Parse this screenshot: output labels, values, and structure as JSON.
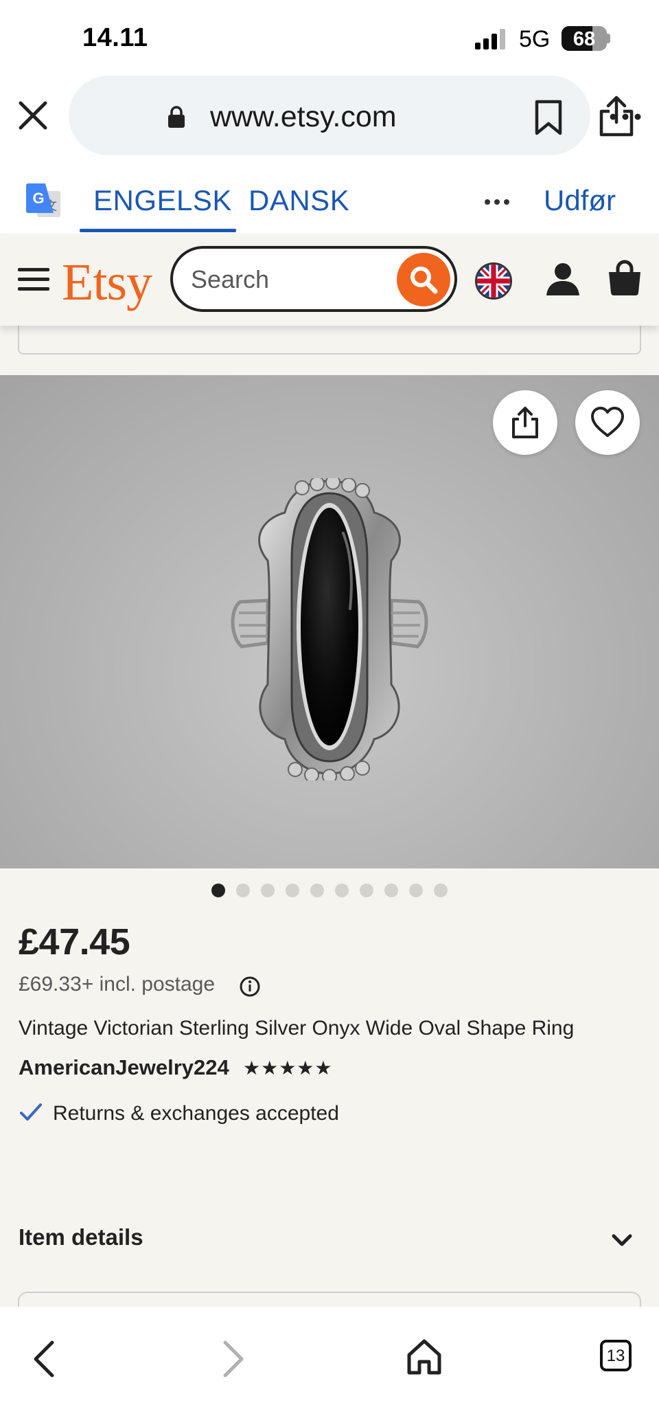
{
  "status_bar": {
    "time": "14.11",
    "network": "5G",
    "battery": "68",
    "battery_level": 0.68
  },
  "browser": {
    "url": "www.etsy.com"
  },
  "translate_bar": {
    "tab_english": "ENGELSK",
    "tab_danish": "DANSK",
    "action": "Udfør"
  },
  "etsy_header": {
    "logo": "Etsy",
    "search_placeholder": "Search",
    "accent_color": "#f1641e"
  },
  "gallery": {
    "image_count": 10,
    "active_index": 0
  },
  "product": {
    "price": "£47.45",
    "postage_price": "£69.33+ incl. postage",
    "title": "Vintage Victorian Sterling Silver Onyx Wide Oval Shape Ring",
    "shop_name": "AmericanJewelry224",
    "rating_stars": "★★★★★",
    "rating": 5,
    "returns": "Returns & exchanges accepted"
  },
  "item_details": {
    "label": "Item details"
  },
  "toolbar": {
    "tab_count": "13"
  },
  "colors": {
    "link_blue": "#1a57b4",
    "page_bg": "#f5f4ef",
    "etsy_orange": "#f1641e"
  }
}
